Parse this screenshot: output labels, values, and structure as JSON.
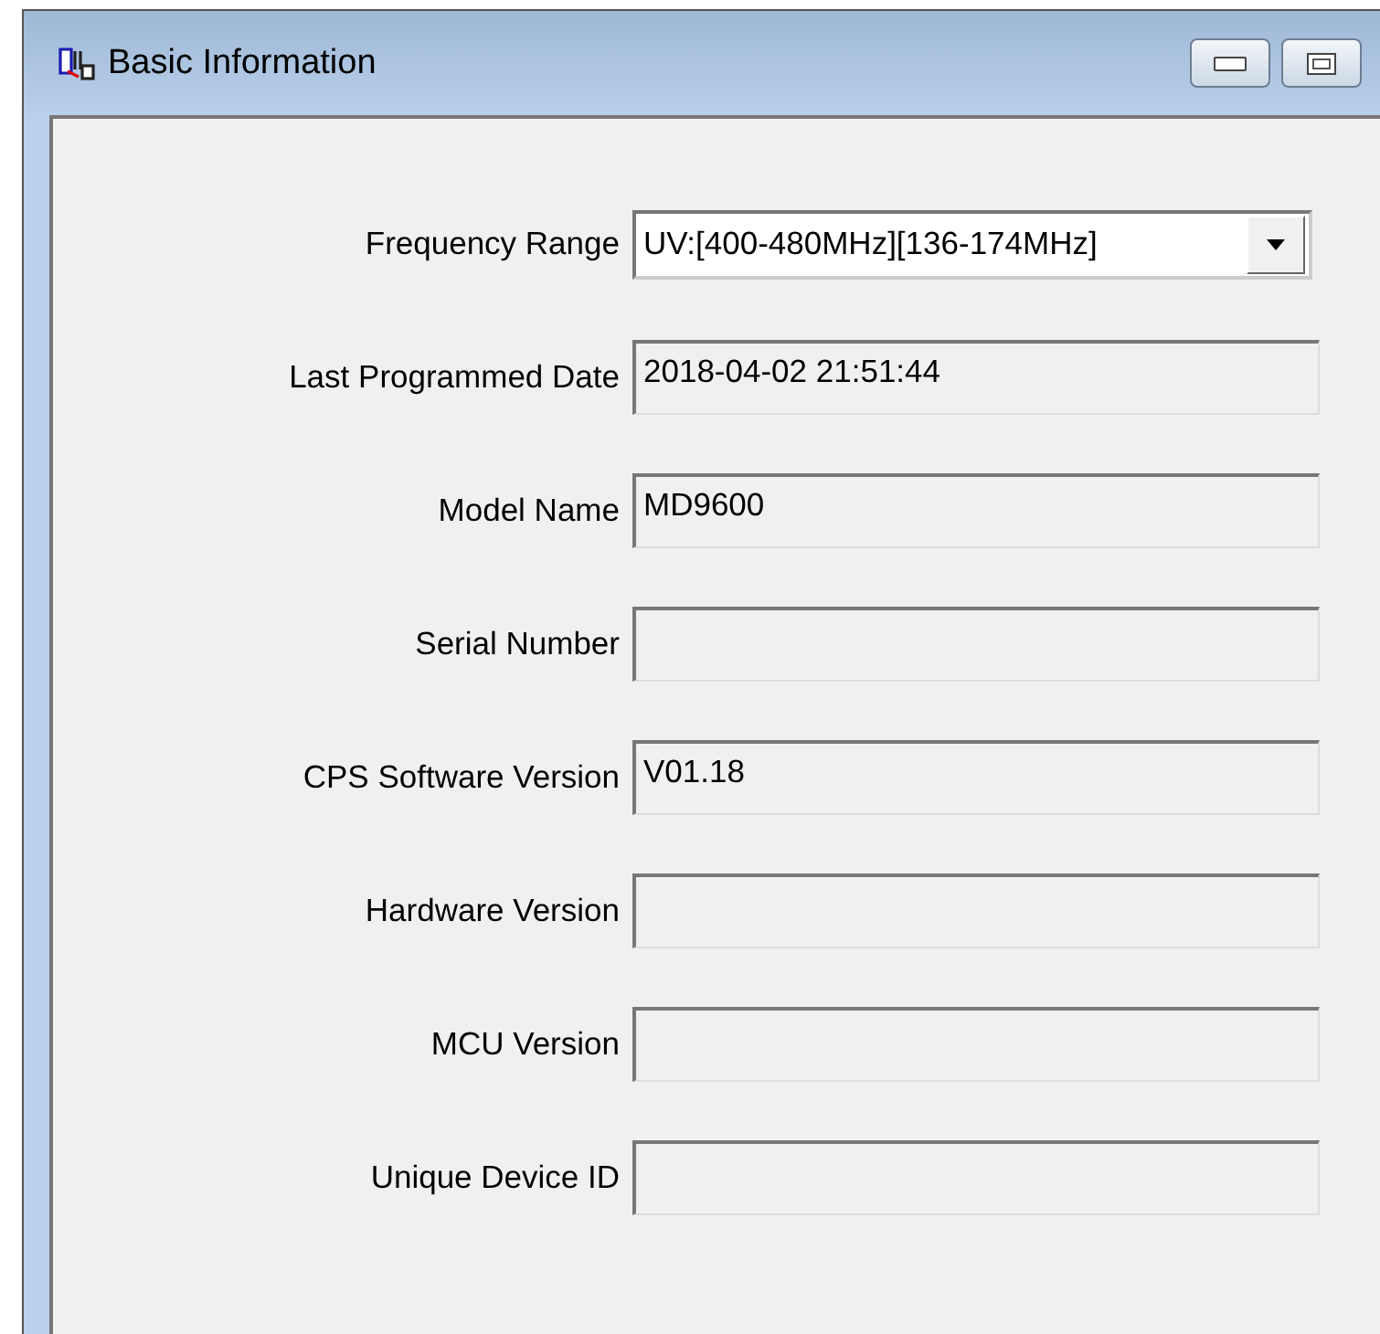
{
  "window": {
    "title": "Basic Information"
  },
  "fields": [
    {
      "label": "Frequency Range",
      "kind": "dropdown",
      "value": "UV:[400-480MHz][136-174MHz]"
    },
    {
      "label": "Last Programmed Date",
      "kind": "text",
      "value": "2018-04-02 21:51:44"
    },
    {
      "label": "Model Name",
      "kind": "text",
      "value": "MD9600"
    },
    {
      "label": "Serial Number",
      "kind": "text"
    },
    {
      "label": "CPS Software Version",
      "kind": "text",
      "value": "V01.18"
    },
    {
      "label": "Hardware Version",
      "kind": "text"
    },
    {
      "label": "MCU Version",
      "kind": "text"
    },
    {
      "label": "Unique Device ID",
      "kind": "text"
    }
  ]
}
